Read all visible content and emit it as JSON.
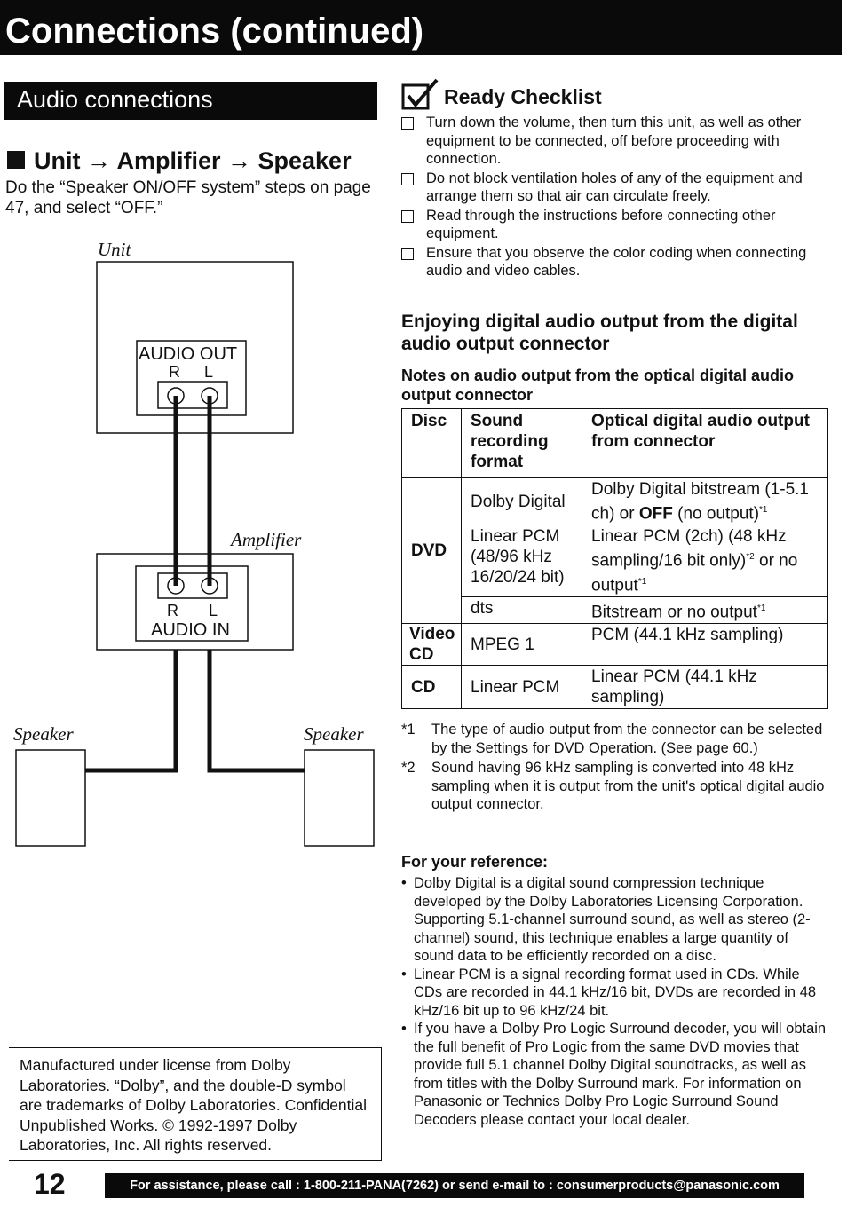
{
  "page_title": "Connections (continued)",
  "section_title": "Audio connections",
  "unit_section": {
    "heading": "Unit → Amplifier → Speaker",
    "text": "Do the “Speaker ON/OFF system” steps on page 47, and select “OFF.”"
  },
  "diagram": {
    "unit": "Unit",
    "audio_out": "AUDIO OUT",
    "r": "R",
    "l": "L",
    "amplifier": "Amplifier",
    "audio_in": "AUDIO IN",
    "speaker_left": "Speaker",
    "speaker_right": "Speaker"
  },
  "checklist": {
    "title": "Ready Checklist",
    "items": [
      "Turn down the volume, then turn this unit, as well as other equipment to be connected, off before proceeding with connection.",
      "Do not block ventilation holes of any of the equipment and arrange them so that air can circulate freely.",
      "Read through the instructions before connecting other equipment.",
      "Ensure that you observe the color coding when connecting audio and video cables."
    ]
  },
  "digital": {
    "heading": "Enjoying digital audio output from the digital audio output connector",
    "notes_heading": "Notes on audio output from the optical digital audio output connector"
  },
  "table": {
    "headers": [
      "Disc",
      "Sound recording format",
      "Optical digital audio output from connector"
    ],
    "rows": [
      {
        "disc": "DVD",
        "format": "Dolby Digital",
        "output_a": "Dolby Digital bitstream (1-5.1 ch) or ",
        "output_b": "OFF",
        "output_c": " (no output)",
        "sup": "*1"
      },
      {
        "format": "Linear PCM (48/96 kHz 16/20/24 bit)",
        "output_a": "Linear PCM (2ch) (48 kHz sampling/16 bit only)",
        "sup1": "*2",
        "output_b": " or no output",
        "sup2": "*1"
      },
      {
        "format": "dts",
        "output_a": "Bitstream or no output",
        "sup": "*1"
      },
      {
        "disc": "Video CD",
        "format": "MPEG 1",
        "output": "PCM (44.1 kHz sampling)"
      },
      {
        "disc": "CD",
        "format": "Linear PCM",
        "output": "Linear PCM (44.1 kHz sampling)"
      }
    ]
  },
  "footnotes": [
    {
      "key": "*1",
      "text": "The type of audio output from the connector can be selected by the Settings for DVD Operation. (See page 60.)"
    },
    {
      "key": "*2",
      "text": "Sound having 96 kHz sampling is converted into 48 kHz sampling when it is output from the unit's optical digital audio output connector."
    }
  ],
  "reference": {
    "heading": "For your reference:",
    "items": [
      "Dolby Digital is a digital sound compression technique developed by the Dolby Laboratories Licensing Corporation. Supporting 5.1-channel surround sound, as well as stereo (2-channel) sound, this technique enables a large quantity of sound data to be efficiently recorded on a disc.",
      "Linear PCM is a signal recording format used in CDs. While CDs are recorded in 44.1 kHz/16 bit, DVDs are recorded in 48 kHz/16 bit up to 96 kHz/24 bit.",
      "If you have a Dolby Pro Logic Surround decoder, you will obtain the full benefit of Pro Logic from the same DVD movies that provide full 5.1 channel Dolby Digital soundtracks, as well as from titles with the Dolby Surround mark. For information on Panasonic or Technics Dolby Pro Logic Surround Sound Decoders please contact your local dealer."
    ]
  },
  "dolby_notice": "Manufactured under license from Dolby Laboratories. “Dolby”, and the double-D symbol are trademarks of Dolby Laboratories. Confidential Unpublished Works. © 1992-1997 Dolby Laboratories, Inc. All rights reserved.",
  "footer": {
    "page_number": "12",
    "help_text": "For assistance, please call : 1-800-211-PANA(7262) or send e-mail to : consumerproducts@panasonic.com"
  }
}
